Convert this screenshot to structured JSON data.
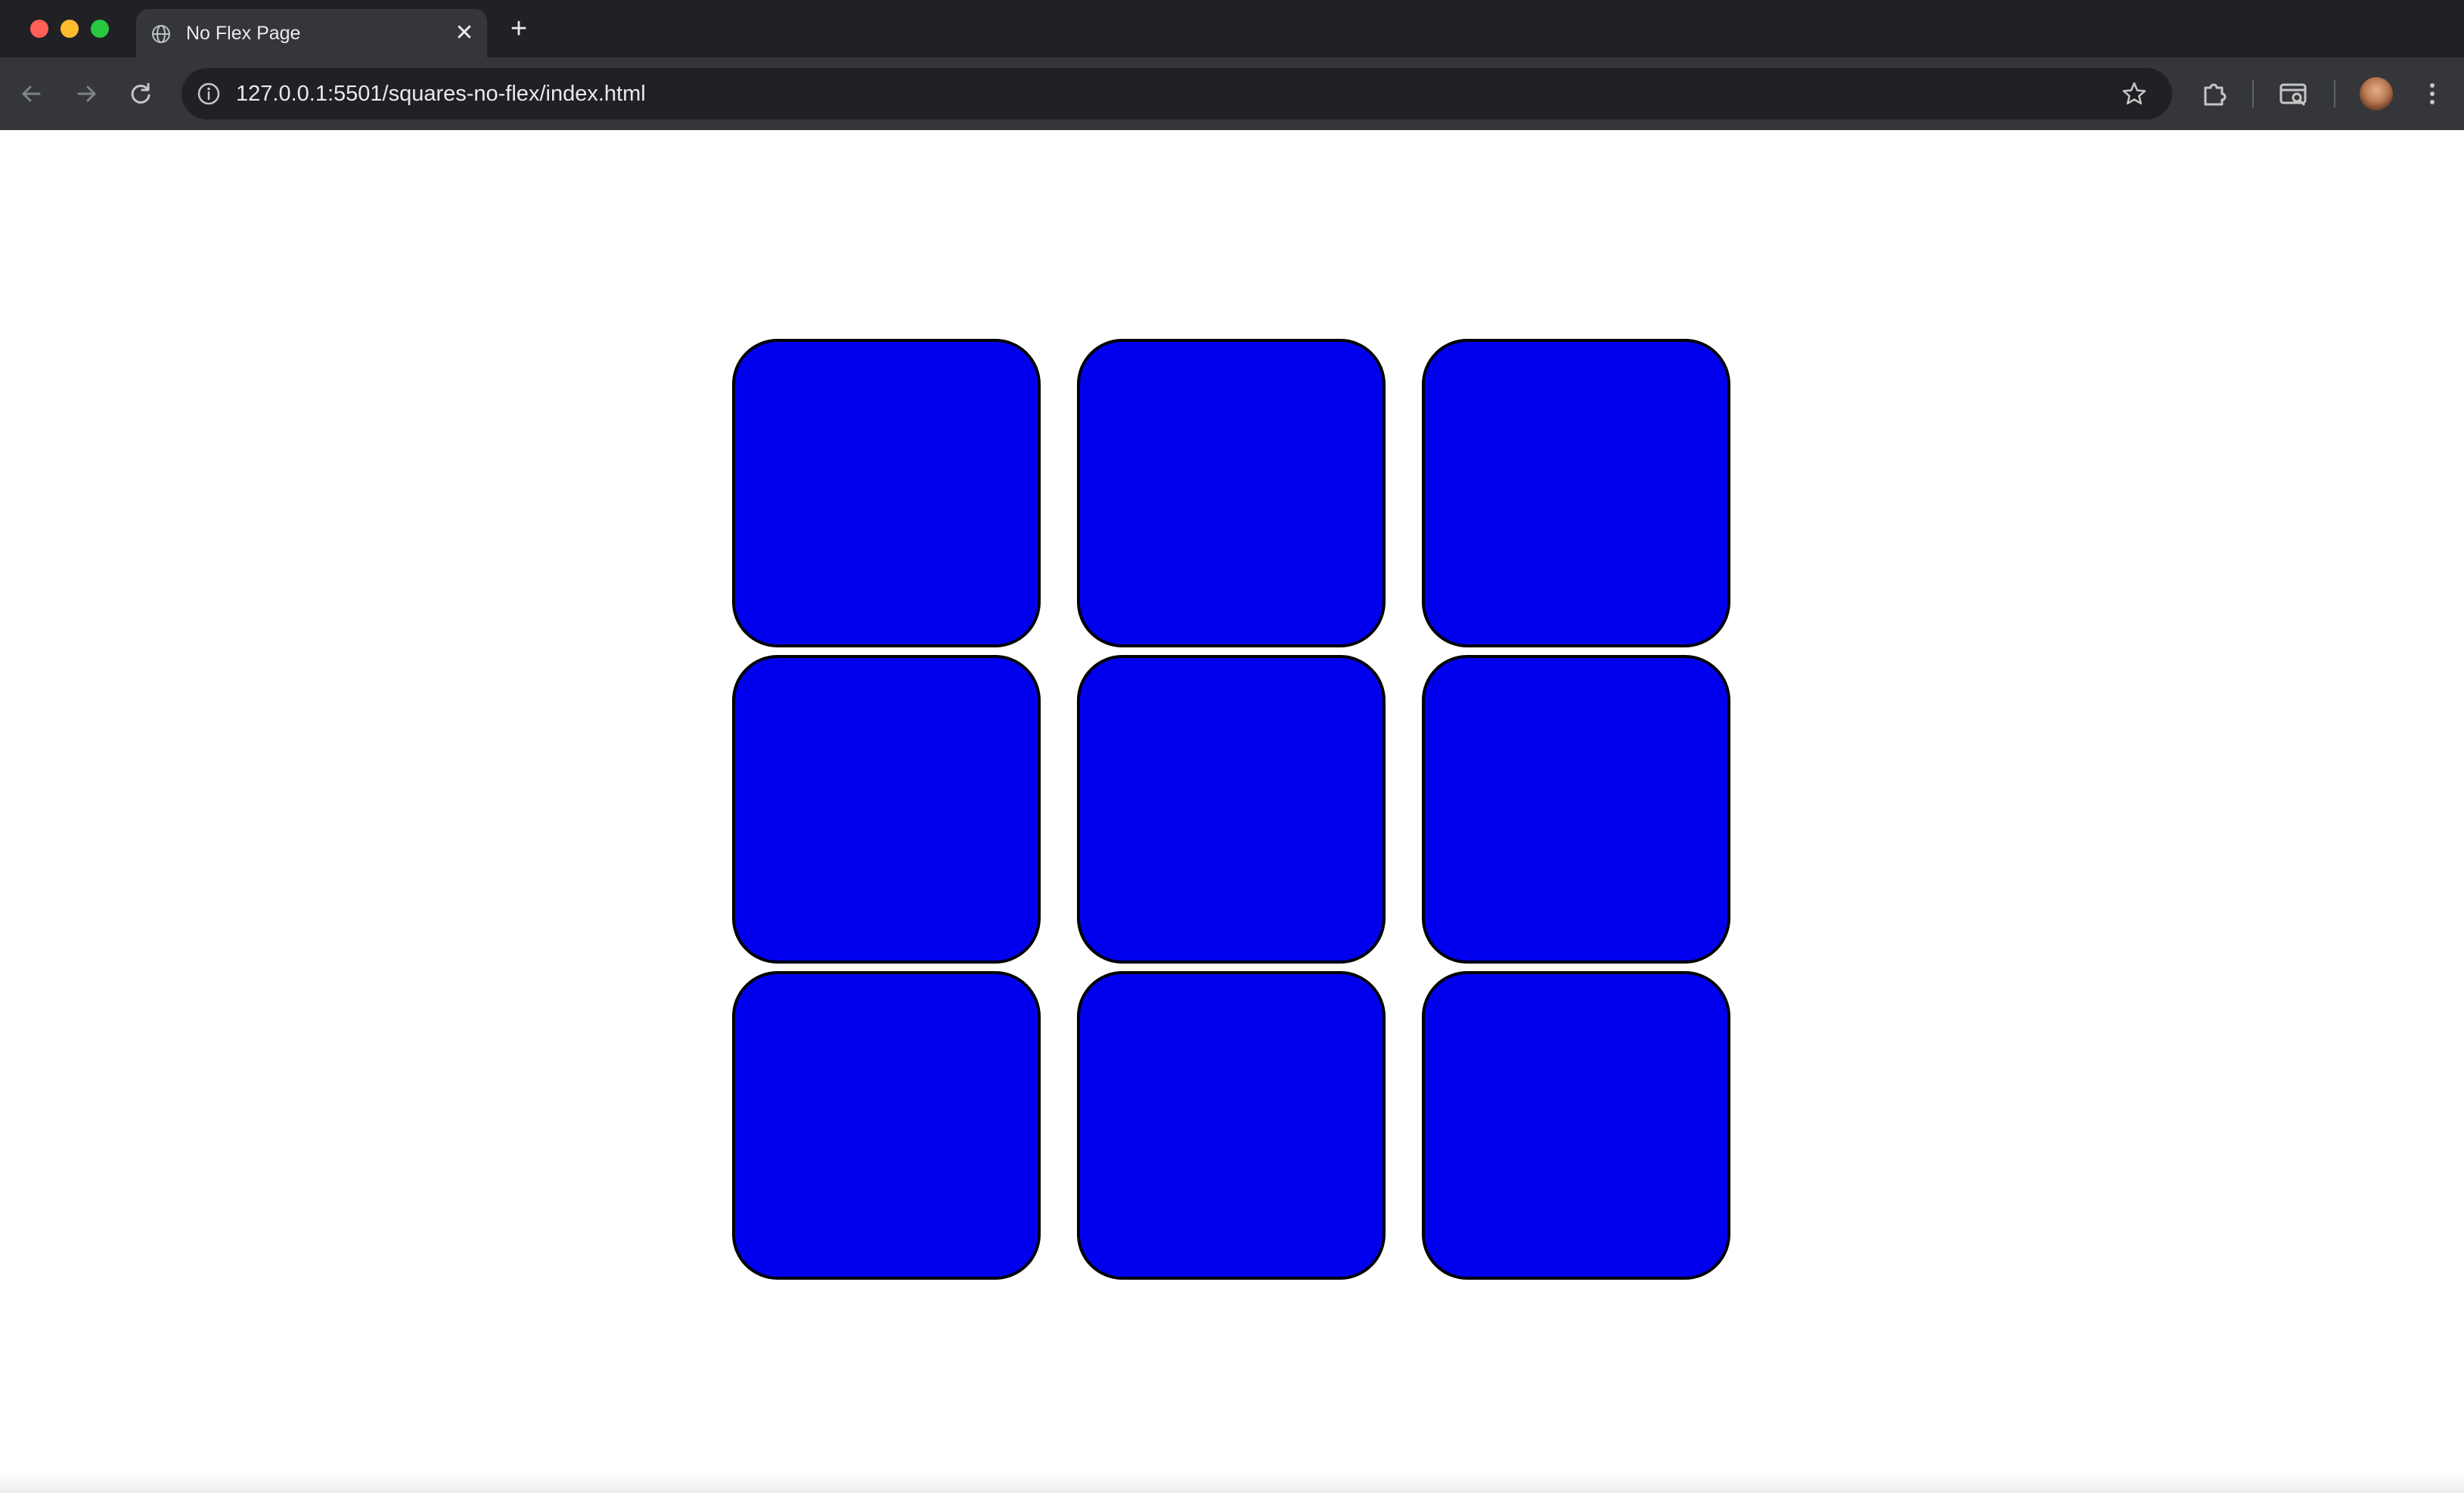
{
  "browser": {
    "tab": {
      "title": "No Flex Page",
      "favicon": "globe-icon",
      "close_glyph": "✕"
    },
    "new_tab_glyph": "+",
    "address_bar": {
      "url": "127.0.0.1:5501/squares-no-flex/index.html",
      "site_info_icon": "info-icon",
      "bookmark_icon": "star-icon"
    },
    "toolbar_icons": [
      "back-arrow-icon",
      "forward-arrow-icon",
      "reload-icon",
      "extensions-puzzle-icon",
      "tab-search-icon",
      "profile-avatar",
      "kebab-menu-icon"
    ]
  },
  "page": {
    "background": "#ffffff",
    "square_color": "#0000ee",
    "square_border_color": "#000000",
    "rows": 3,
    "columns": 3,
    "square_count": 9
  }
}
